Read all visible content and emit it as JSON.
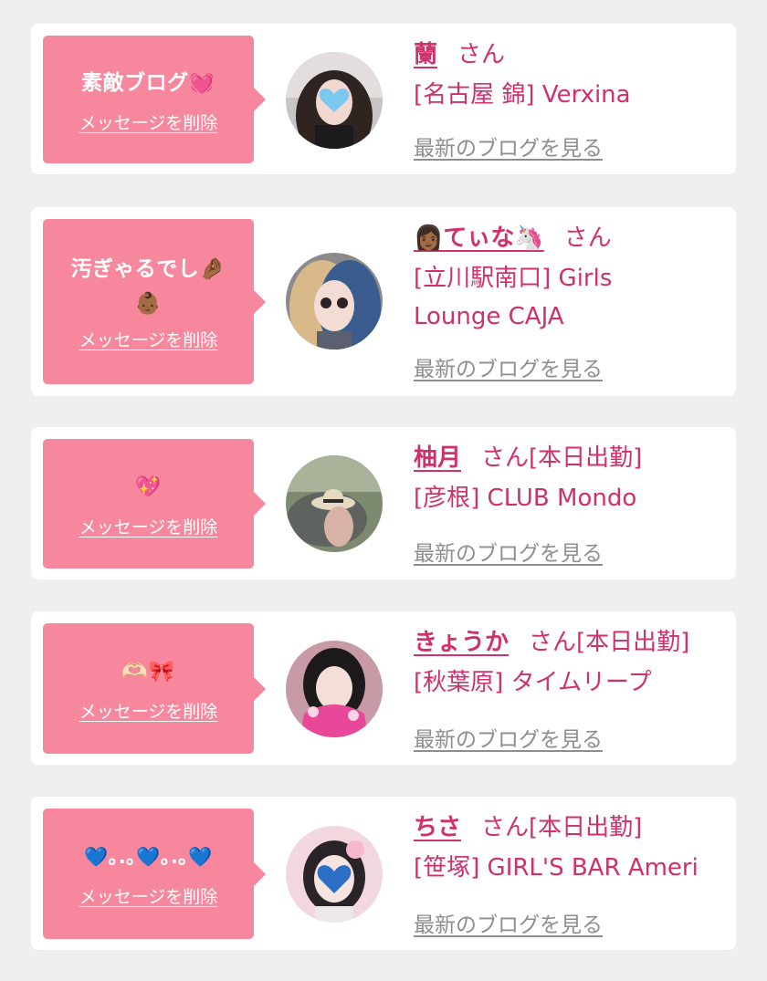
{
  "delete_label": "メッセージを削除",
  "blog_link_label": "最新のブログを見る",
  "colors": {
    "accent": "#d0306b",
    "bubble": "#f7879d",
    "background": "#efeff0",
    "link_gray": "#8e8e8e"
  },
  "entries": [
    {
      "message": "素敵ブログ💓",
      "name": "蘭",
      "suffix": "さん",
      "shop": "[名古屋 錦] Verxina",
      "avatar": "girl-with-heart-emoji-over-face"
    },
    {
      "message": "汚ぎゃるでし🤌🏾👶🏾",
      "name": "👩🏾てぃな🦄",
      "suffix": "さん",
      "shop": "[立川駅南口] Girls Lounge CAJA",
      "avatar": "girl-with-blonde-blue-hair"
    },
    {
      "message": "💖",
      "name": "柚月",
      "suffix": "さん[本日出勤]",
      "shop": "[彦根] CLUB Mondo",
      "avatar": "girl-with-sun-hat-outdoors"
    },
    {
      "message": "🫶🏻🎀",
      "name": "きょうか",
      "suffix": "さん[本日出勤]",
      "shop": "[秋葉原] タイムリープ",
      "avatar": "girl-in-pink-kimono-winking"
    },
    {
      "message": "💙｡.｡💙｡.｡💙",
      "name": "ちさ",
      "suffix": "さん[本日出勤]",
      "shop": "[笹塚] GIRL'S BAR Ameri",
      "avatar": "girl-with-blue-heart-emoji-over-face"
    }
  ]
}
